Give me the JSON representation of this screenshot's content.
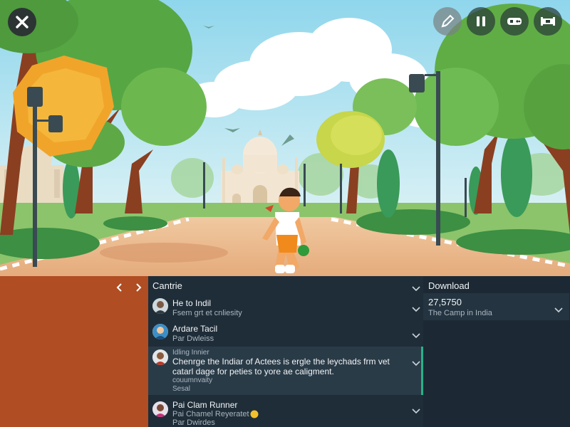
{
  "hud": {
    "close_icon": "close-icon",
    "buttons": [
      "pencil-icon",
      "pause-icon",
      "gamepad-icon",
      "map-icon"
    ]
  },
  "nav": {
    "prev_icon": "chevron-left-icon",
    "next_icon": "chevron-right-icon"
  },
  "center_panel": {
    "title": "Cantrie",
    "items": [
      {
        "title": "He to Indil",
        "subtitle": "Fsem grt et cnliesity"
      },
      {
        "title": "Ardare Tacil",
        "subtitle": "Par Dwleiss"
      },
      {
        "label": "Idling Innier",
        "body": "Chenrge the Indiar of Actees is ergle the leychads frm vet catarl dage for peties to yore ae caligment.",
        "extra": "couumnvaity",
        "footer": "Sesal"
      },
      {
        "title": "Pai Clam Runner",
        "subtitle": "Pai Chamel Reyeratet",
        "subtitle2": "Par Dwirdes"
      }
    ]
  },
  "right_panel": {
    "title": "Download",
    "value": "27,5750",
    "subtitle": "The Camp in India"
  },
  "colors": {
    "left_pane": "#b04d22",
    "panel_bg": "#1f2d38",
    "accent": "#27b389"
  }
}
